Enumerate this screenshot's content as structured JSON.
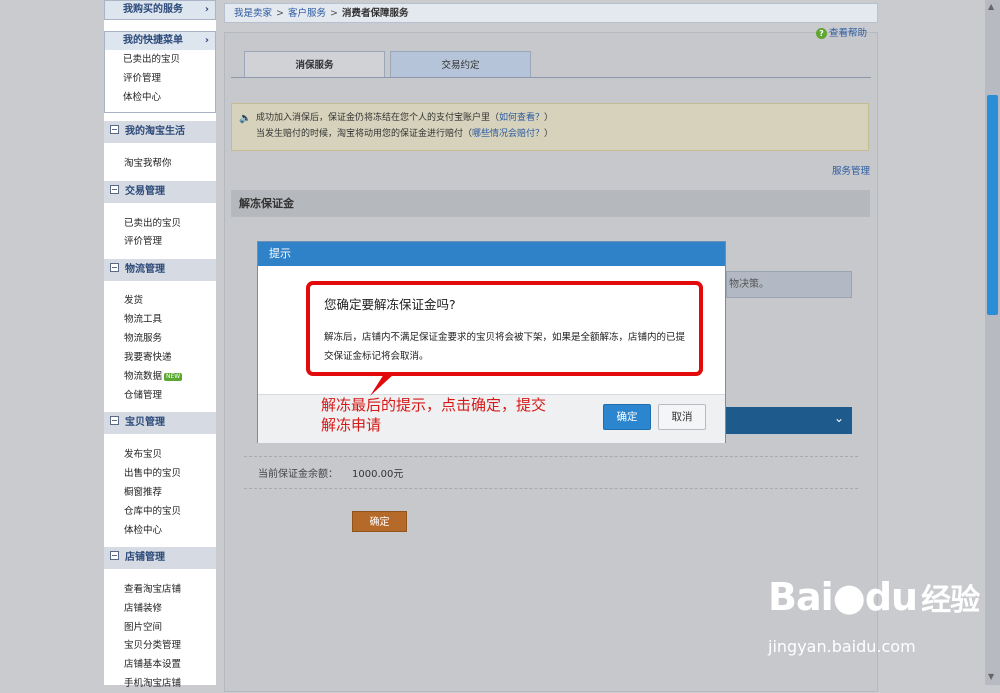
{
  "sidebar": {
    "top_box": {
      "label": "我购买的服务",
      "chevron": "›"
    },
    "quick_menu": {
      "title": "我的快捷菜单",
      "chevron": "›",
      "items": [
        "已卖出的宝贝",
        "评价管理",
        "体检中心"
      ]
    },
    "sections": [
      {
        "title": "我的淘宝生活",
        "items": [
          "淘宝我帮你"
        ]
      },
      {
        "title": "交易管理",
        "items": [
          "已卖出的宝贝",
          "评价管理"
        ]
      },
      {
        "title": "物流管理",
        "items": [
          "发货",
          "物流工具",
          "物流服务",
          "我要寄快递",
          "物流数据",
          "仓储管理"
        ],
        "new_badge": "NEW"
      },
      {
        "title": "宝贝管理",
        "items": [
          "发布宝贝",
          "出售中的宝贝",
          "橱窗推荐",
          "仓库中的宝贝",
          "体检中心"
        ]
      },
      {
        "title": "店铺管理",
        "items": [
          "查看淘宝店铺",
          "店铺装修",
          "图片空间",
          "宝贝分类管理",
          "店铺基本设置",
          "手机淘宝店铺"
        ]
      }
    ]
  },
  "breadcrumb": {
    "items": [
      "我是卖家",
      "客户服务"
    ],
    "separator": ">",
    "current": "消费者保障服务"
  },
  "help": {
    "label": "查看帮助",
    "icon": "question-icon"
  },
  "tabs": [
    {
      "label": "消保服务",
      "active": true
    },
    {
      "label": "交易约定",
      "active": false
    }
  ],
  "notice": {
    "line1_text": "成功加入消保后，保证金仍将冻结在您个人的支付宝账户里（",
    "line1_link": "如何查看？",
    "line1_end": "）",
    "line2_text": "当发生赔付的时候，淘宝将动用您的保证金进行赔付（",
    "line2_link": "哪些情况会赔付？",
    "line2_end": "）"
  },
  "service_manage_link": "服务管理",
  "section_title": "解冻保证金",
  "obscured_field_text": "物决策。",
  "balance": {
    "label": "当前保证金余额：",
    "amount": "1000.00元"
  },
  "confirm_button": "确定",
  "dialog": {
    "title": "提示",
    "question": "您确定要解冻保证金吗?",
    "body": "解冻后，店铺内不满足保证金要求的宝贝将会被下架，如果是全额解冻，店铺内的已提交保证金标记将会取消。",
    "ok_label": "确定",
    "cancel_label": "取消"
  },
  "annotation": {
    "line1": "解冻最后的提示，点击确定，提交",
    "line2": "解冻申请"
  },
  "watermark": {
    "brand": "Bai",
    "brand2": "du",
    "cn": "经验",
    "url": "jingyan.baidu.com"
  },
  "colors": {
    "accent": "#2f82c8",
    "highlight": "#e20a0a",
    "primary_button": "#b56a2a"
  }
}
